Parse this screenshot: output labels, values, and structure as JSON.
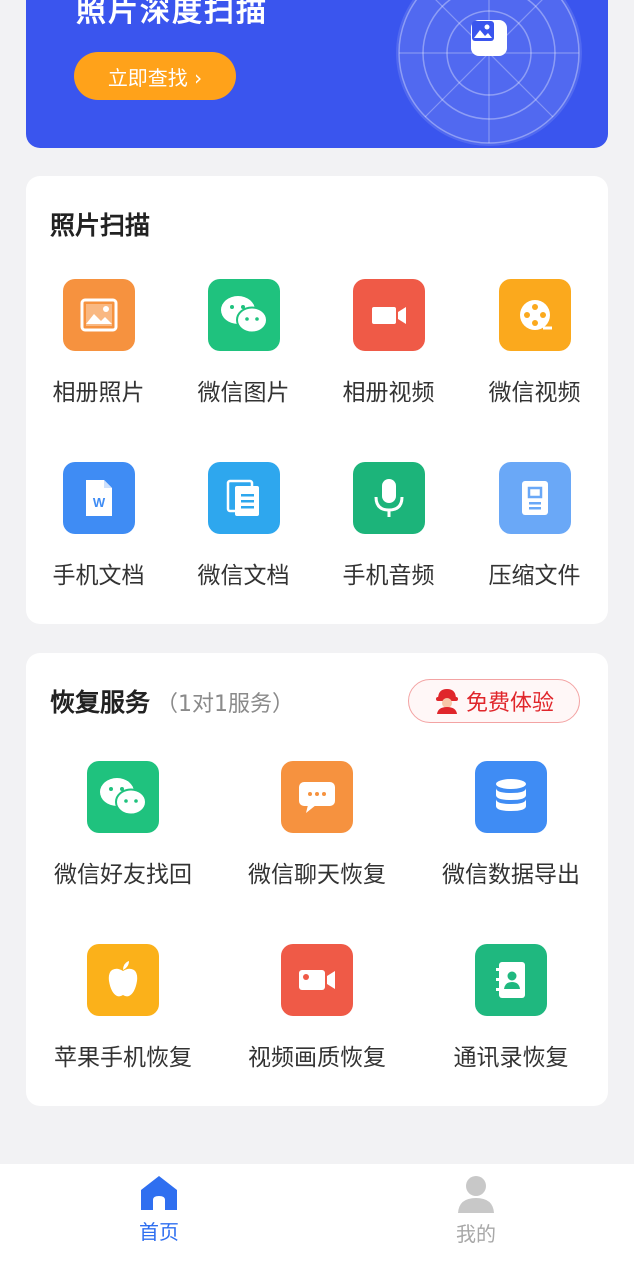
{
  "banner": {
    "title": "照片深度扫描",
    "button_label": "立即查找 ›"
  },
  "scan": {
    "title": "照片扫描",
    "items": [
      {
        "label": "相册照片",
        "icon": "image-icon",
        "color": "#f6923f"
      },
      {
        "label": "微信图片",
        "icon": "wechat-icon",
        "color": "#1fc27e"
      },
      {
        "label": "相册视频",
        "icon": "video-icon",
        "color": "#ef5a47"
      },
      {
        "label": "微信视频",
        "icon": "film-reel-icon",
        "color": "#fba91d"
      },
      {
        "label": "手机文档",
        "icon": "word-doc-icon",
        "color": "#3f8cf4"
      },
      {
        "label": "微信文档",
        "icon": "documents-icon",
        "color": "#2ea7ee"
      },
      {
        "label": "手机音频",
        "icon": "microphone-icon",
        "color": "#1cb47a"
      },
      {
        "label": "压缩文件",
        "icon": "archive-icon",
        "color": "#6aa8f7"
      }
    ]
  },
  "service": {
    "title": "恢复服务",
    "subtitle": "（1对1服务）",
    "free_label": "免费体验",
    "items": [
      {
        "label": "微信好友找回",
        "icon": "wechat-icon",
        "color": "#1fc27e"
      },
      {
        "label": "微信聊天恢复",
        "icon": "chat-bubble-icon",
        "color": "#f6923f"
      },
      {
        "label": "微信数据导出",
        "icon": "database-icon",
        "color": "#3f8cf4"
      },
      {
        "label": "苹果手机恢复",
        "icon": "apple-icon",
        "color": "#fbb11a"
      },
      {
        "label": "视频画质恢复",
        "icon": "video-camera-icon",
        "color": "#ef5a47"
      },
      {
        "label": "通讯录恢复",
        "icon": "contacts-icon",
        "color": "#1fb87f"
      }
    ]
  },
  "nav": {
    "home_label": "首页",
    "mine_label": "我的",
    "active_color": "#2f6ff0",
    "inactive_color": "#a8a8a8"
  }
}
